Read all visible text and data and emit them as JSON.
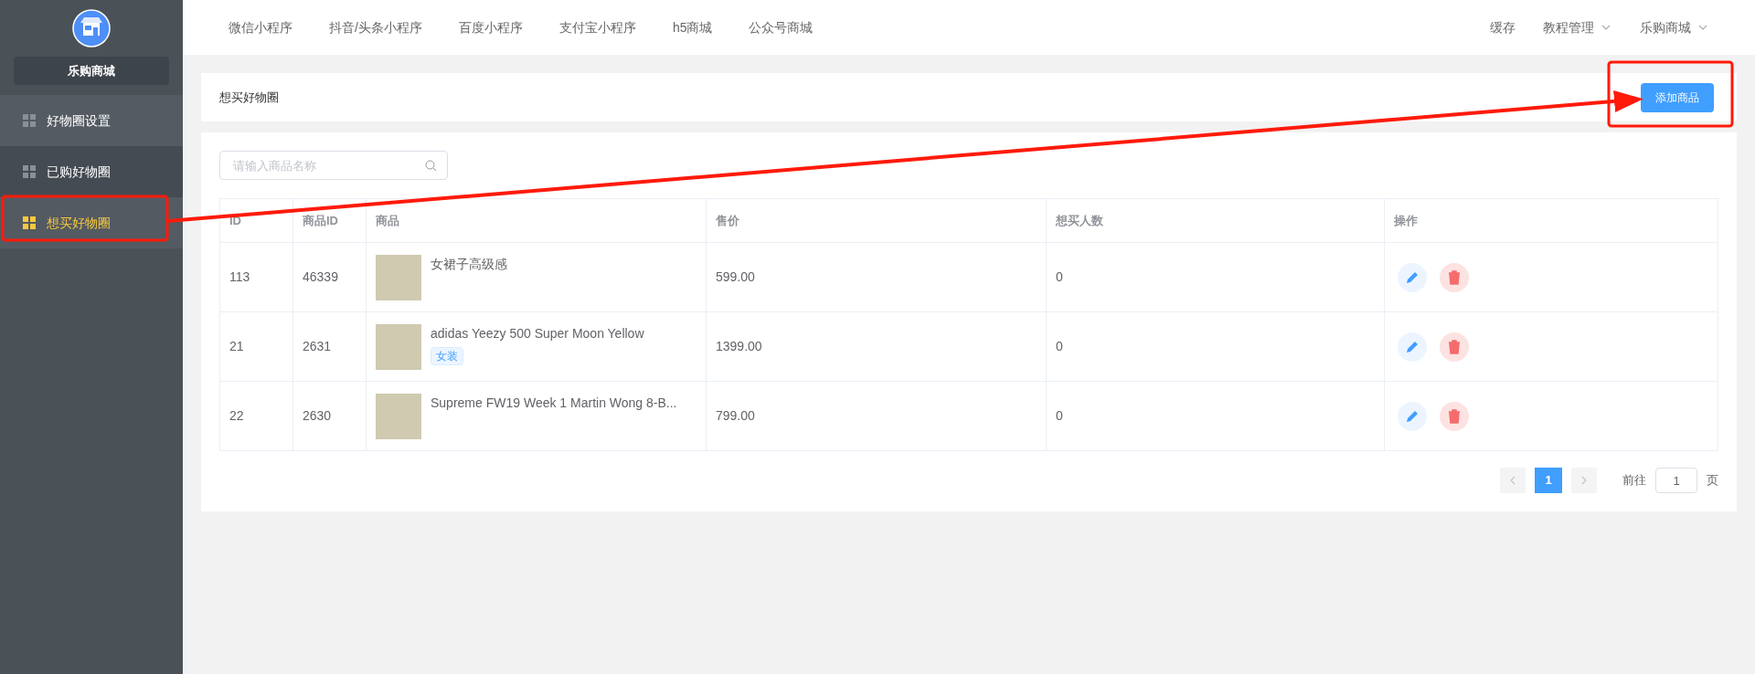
{
  "sidebar": {
    "shop_name": "乐购商城",
    "items": [
      {
        "label": "好物圈设置",
        "selected": false,
        "hovered": true
      },
      {
        "label": "已购好物圈",
        "selected": false,
        "hovered": false
      },
      {
        "label": "想买好物圈",
        "selected": true,
        "hovered": false
      }
    ]
  },
  "top_nav": {
    "items": [
      "微信小程序",
      "抖音/头条小程序",
      "百度小程序",
      "支付宝小程序",
      "h5商城",
      "公众号商城"
    ],
    "right": [
      {
        "label": "缓存",
        "dropdown": false
      },
      {
        "label": "教程管理",
        "dropdown": true
      },
      {
        "label": "乐购商城",
        "dropdown": true
      }
    ]
  },
  "page_header": {
    "title": "想买好物圈",
    "button": "添加商品"
  },
  "search": {
    "placeholder": "请输入商品名称"
  },
  "table": {
    "columns": [
      "ID",
      "商品ID",
      "商品",
      "售价",
      "想买人数",
      "操作"
    ],
    "rows": [
      {
        "id": "113",
        "goods_id": "46339",
        "name": "女裙子高级感",
        "price": "599.00",
        "count": "0"
      },
      {
        "id": "21",
        "goods_id": "2631",
        "name": "adidas Yeezy 500 Super Moon Yellow",
        "tag": "女装",
        "price": "1399.00",
        "count": "0"
      },
      {
        "id": "22",
        "goods_id": "2630",
        "name": "Supreme FW19 Week 1 Martin Wong 8-B...",
        "price": "799.00",
        "count": "0"
      }
    ]
  },
  "pagination": {
    "pages": [
      {
        "label": "1",
        "selected": true
      }
    ],
    "goto_prefix": "前往",
    "goto_value": "1",
    "goto_suffix": "页"
  }
}
